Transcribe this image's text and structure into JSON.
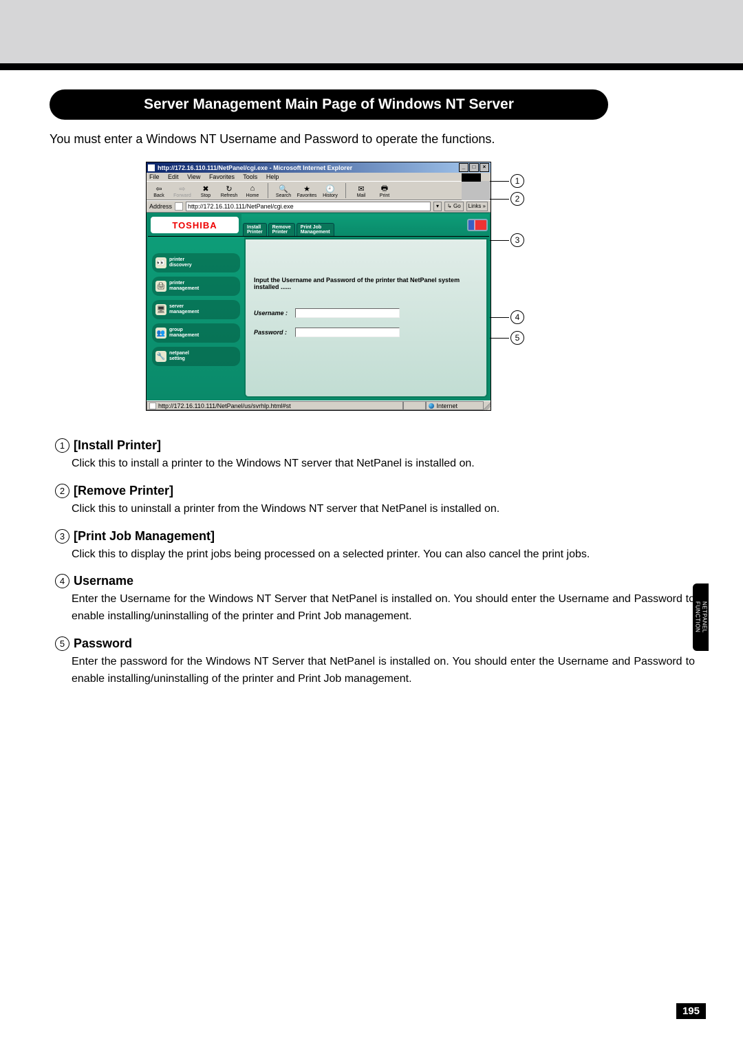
{
  "page": {
    "title": "Server Management  Main Page of Windows NT Server",
    "lead": "You must enter a Windows NT Username and Password to operate the functions.",
    "page_number": "195",
    "side_tab": "NETPANEL\nFUNCTION"
  },
  "ie": {
    "window_title": "http://172.16.110.111/NetPanel/cgi.exe - Microsoft Internet Explorer",
    "menus": [
      "File",
      "Edit",
      "View",
      "Favorites",
      "Tools",
      "Help"
    ],
    "toolbar": {
      "back": "Back",
      "forward": "Forward",
      "stop": "Stop",
      "refresh": "Refresh",
      "home": "Home",
      "search": "Search",
      "favorites": "Favorites",
      "history": "History",
      "mail": "Mail",
      "print": "Print"
    },
    "address_label": "Address",
    "address_value": "http://172.16.110.111/NetPanel/cgi.exe",
    "go": "Go",
    "links": "Links »",
    "status_left": "http://172.16.110.111/NetPanel/us/svrhlp.html#st",
    "status_right": "Internet"
  },
  "netpanel": {
    "logo": "TOSHIBA",
    "tabs": {
      "install": "Install\nPrinter",
      "remove": "Remove\nPrinter",
      "printjob": "Print Job\nManagement"
    },
    "sidebar": [
      {
        "icon": "binoculars-icon",
        "label": "printer\ndiscovery"
      },
      {
        "icon": "printer-icon",
        "label": "printer\nmanagement"
      },
      {
        "icon": "server-icon",
        "label": "server\nmanagement"
      },
      {
        "icon": "group-icon",
        "label": "group\nmanagement"
      },
      {
        "icon": "settings-icon",
        "label": "netpanel\nsetting"
      }
    ],
    "main": {
      "prompt": "Input the Username and Password of the printer that NetPanel system installed ......",
      "username_label": "Username :",
      "password_label": "Password :"
    }
  },
  "callouts": [
    "1",
    "2",
    "3",
    "4",
    "5"
  ],
  "defs": [
    {
      "num": "1",
      "head": "[Install Printer]",
      "body": "Click this to install a printer to the Windows NT server that NetPanel is installed on."
    },
    {
      "num": "2",
      "head": "[Remove Printer]",
      "body": "Click this to uninstall a printer from the Windows NT server that NetPanel is installed on."
    },
    {
      "num": "3",
      "head": "[Print Job Management]",
      "body": "Click this to display the print jobs being processed on a selected printer.  You can also cancel the print jobs."
    },
    {
      "num": "4",
      "head": "Username",
      "body": "Enter the Username for the Windows NT Server that NetPanel is installed on. You should enter the Username and Password to enable installing/uninstalling of the printer and Print Job management."
    },
    {
      "num": "5",
      "head": "Password",
      "body": "Enter the password for the Windows NT Server that NetPanel is installed on. You should enter the Username and Password to enable installing/uninstalling of the printer and Print Job management."
    }
  ]
}
